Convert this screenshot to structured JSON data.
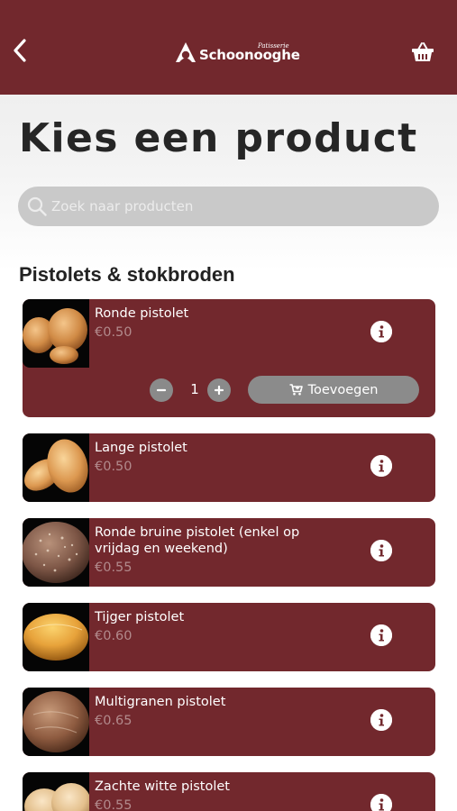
{
  "header": {
    "logo_sub": "Patisserie",
    "logo_name": "Schoonooghe",
    "brand_color": "#72282d",
    "back_icon": "chevron-left-icon",
    "cart_icon": "basket-icon"
  },
  "page_title": "Kies een product",
  "search": {
    "placeholder": "Zoek naar producten",
    "value": ""
  },
  "section_title": "Pistolets & stokbroden",
  "products": [
    {
      "name": "Ronde pistolet",
      "price": "€0.50",
      "expanded": true,
      "quantity": "1",
      "add_label": "Toevoegen"
    },
    {
      "name": "Lange pistolet",
      "price": "€0.50"
    },
    {
      "name": "Ronde bruine pistolet (enkel op vrijdag en weekend)",
      "price": "€0.55"
    },
    {
      "name": "Tijger pistolet",
      "price": "€0.60"
    },
    {
      "name": "Multigranen pistolet",
      "price": "€0.65"
    },
    {
      "name": "Zachte witte pistolet",
      "price": "€0.55"
    }
  ]
}
